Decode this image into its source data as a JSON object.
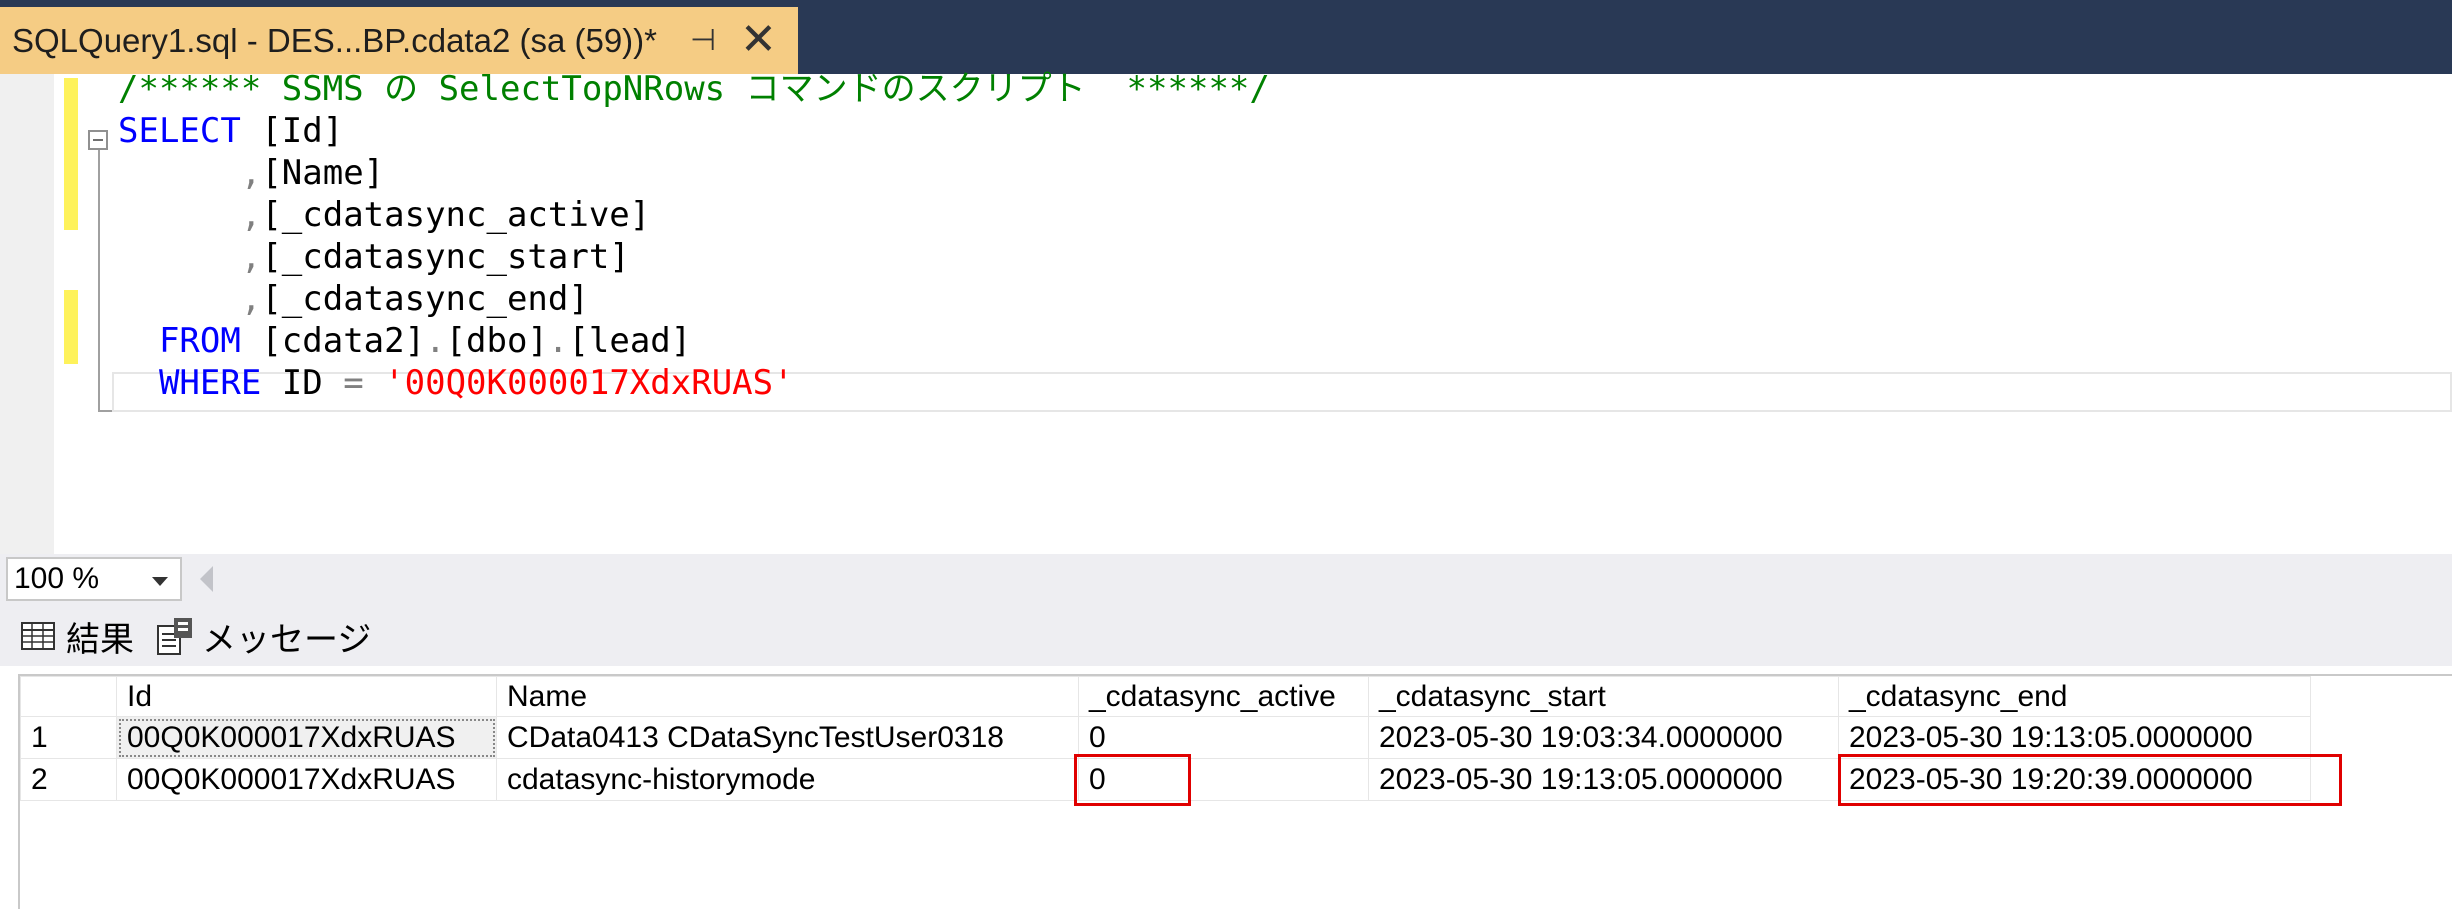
{
  "tab": {
    "title": "SQLQuery1.sql - DES...BP.cdata2 (sa (59))*",
    "pin_icon": "pin-icon",
    "close_icon": "close-icon"
  },
  "editor": {
    "lines": [
      [
        {
          "t": "/****** SSMS の SelectTopNRows コマンドのスクリプト  ******/",
          "c": "cm"
        }
      ],
      [
        {
          "t": "SELECT",
          "c": "kw"
        },
        {
          "t": " [Id]",
          "c": ""
        }
      ],
      [
        {
          "t": "      ",
          "c": ""
        },
        {
          "t": ",",
          "c": "gr"
        },
        {
          "t": "[Name]",
          "c": ""
        }
      ],
      [
        {
          "t": "      ",
          "c": ""
        },
        {
          "t": ",",
          "c": "gr"
        },
        {
          "t": "[_cdatasync_active]",
          "c": ""
        }
      ],
      [
        {
          "t": "      ",
          "c": ""
        },
        {
          "t": ",",
          "c": "gr"
        },
        {
          "t": "[_cdatasync_start]",
          "c": ""
        }
      ],
      [
        {
          "t": "      ",
          "c": ""
        },
        {
          "t": ",",
          "c": "gr"
        },
        {
          "t": "[_cdatasync_end]",
          "c": ""
        }
      ],
      [
        {
          "t": "  ",
          "c": ""
        },
        {
          "t": "FROM",
          "c": "kw"
        },
        {
          "t": " [cdata2]",
          "c": ""
        },
        {
          "t": ".",
          "c": "gr"
        },
        {
          "t": "[dbo]",
          "c": ""
        },
        {
          "t": ".",
          "c": "gr"
        },
        {
          "t": "[lead]",
          "c": ""
        }
      ],
      [
        {
          "t": "  ",
          "c": ""
        },
        {
          "t": "WHERE",
          "c": "kw"
        },
        {
          "t": " ID ",
          "c": ""
        },
        {
          "t": "=",
          "c": "gr"
        },
        {
          "t": " ",
          "c": ""
        },
        {
          "t": "'00Q0K000017XdxRUAS'",
          "c": "st"
        }
      ]
    ]
  },
  "zoom": {
    "value": "100 %"
  },
  "result_tabs": [
    {
      "label": "結果",
      "icon": "grid-icon"
    },
    {
      "label": "メッセージ",
      "icon": "messages-icon"
    }
  ],
  "grid": {
    "columns": [
      "",
      "Id",
      "Name",
      "_cdatasync_active",
      "_cdatasync_start",
      "_cdatasync_end"
    ],
    "rows": [
      [
        "1",
        "00Q0K000017XdxRUAS",
        "CData0413 CDataSyncTestUser0318",
        "0",
        "2023-05-30 19:03:34.0000000",
        "2023-05-30 19:13:05.0000000"
      ],
      [
        "2",
        "00Q0K000017XdxRUAS",
        "cdatasync-historymode",
        "0",
        "2023-05-30 19:13:05.0000000",
        "2023-05-30 19:20:39.0000000"
      ]
    ]
  },
  "colors": {
    "tab_active": "#f5cc84",
    "title_bar": "#293955",
    "keyword": "#0000ff",
    "comment": "#008000",
    "string": "#ff0000",
    "highlight_box": "#e00000"
  }
}
